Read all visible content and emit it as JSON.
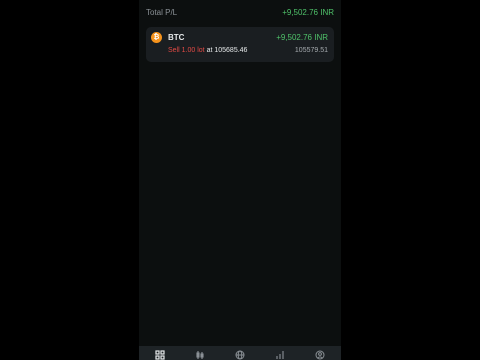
{
  "summary": {
    "label": "Total P/L",
    "value": "+9,502.76 INR",
    "value_color": "#4fc26a"
  },
  "positions": [
    {
      "symbol": "BTC",
      "icon": "bitcoin-icon",
      "icon_glyph": "₿",
      "pnl": "+9,502.76 INR",
      "side": "Sell",
      "lots": "1.00 lot",
      "at_label": "at",
      "open_price": "105685.46",
      "current_price": "105579.51"
    }
  ],
  "bottom_nav": [
    {
      "icon": "grid-icon"
    },
    {
      "icon": "candlestick-icon"
    },
    {
      "icon": "globe-icon"
    },
    {
      "icon": "bar-chart-icon"
    },
    {
      "icon": "profile-icon"
    }
  ],
  "colors": {
    "background": "#0c0f0f",
    "card": "#1a1e21",
    "profit": "#4fc26a",
    "sell": "#e24a45",
    "coin": "#f5931c"
  }
}
